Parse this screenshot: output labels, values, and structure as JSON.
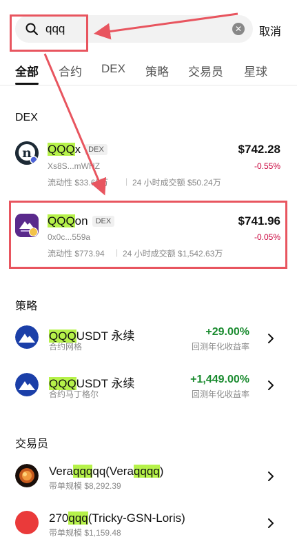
{
  "search": {
    "query": "qqq"
  },
  "header": {
    "cancel_label": "取消"
  },
  "tabs": [
    "全部",
    "合约",
    "DEX",
    "策略",
    "交易员",
    "星球"
  ],
  "sections": {
    "dex": "DEX",
    "strategy": "策略",
    "traders": "交易员"
  },
  "dex_items": [
    {
      "name_hl": "QQQ",
      "name_rest": "x",
      "badge": "DEX",
      "address": "Xs8S...mWHZ",
      "liquidity": "流动性 $33.65万",
      "volume": "24 小时成交额 $50.24万",
      "price": "$742.28",
      "change": "-0.55%"
    },
    {
      "name_hl": "QQQ",
      "name_rest": "on",
      "badge": "DEX",
      "address": "0x0c...559a",
      "liquidity": "流动性 $773.94",
      "volume": "24 小时成交额 $1,542.63万",
      "price": "$741.96",
      "change": "-0.05%"
    }
  ],
  "strategy_items": [
    {
      "name_hl": "QQQ",
      "name_rest": "USDT 永续",
      "subtitle": "合约网格",
      "return": "+29.00%",
      "return_label": "回测年化收益率"
    },
    {
      "name_hl": "QQQ",
      "name_rest": "USDT 永续",
      "subtitle": "合约马丁格尔",
      "return": "+1,449.00%",
      "return_label": "回测年化收益率"
    }
  ],
  "trader_items": [
    {
      "p1": "Vera",
      "h1": "qqq",
      "p2": "qq(Vera",
      "h2": "qqqq",
      "p3": ")",
      "subtitle": "带单规模 $8,292.39"
    },
    {
      "p1": "270",
      "h1": "qqq",
      "p2": "(Tricky-GSN-Loris)",
      "subtitle": "带单规模 $1,159.48"
    }
  ],
  "colors": {
    "highlight": "#b6f24a",
    "positive": "#1a8b2f",
    "negative": "#c9003a",
    "annotation": "#e8555f"
  }
}
